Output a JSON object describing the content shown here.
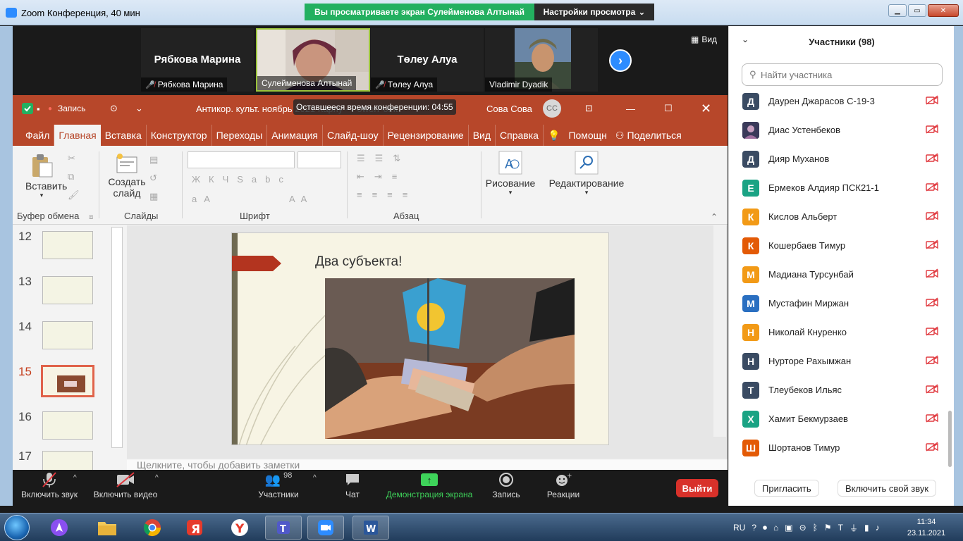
{
  "window": {
    "title": "Zoom Конференция, 40 мин",
    "share_banner": "Вы просматриваете экран Сулейменова Алтынай",
    "view_settings": "Настройки просмотра"
  },
  "videos": [
    {
      "big_name": "Рябкова Марина",
      "tag": "Рябкова Марина",
      "muted": true
    },
    {
      "big_name": "",
      "tag": "Сулейменова Алтынай",
      "muted": false,
      "active": true
    },
    {
      "big_name": "Төлеу Алуа",
      "tag": "Төлеу Алуа",
      "muted": true
    },
    {
      "big_name": "",
      "tag": "Vladimir Dyadik",
      "muted": false
    }
  ],
  "view_label": "Вид",
  "ppt": {
    "record_label": "Запись",
    "doc_title": "Антикор. культ. ноябрь 2021 Карпу - PowerPoint",
    "timer": "Оставшееся время конференции: 04:55",
    "user": "Сова Сова",
    "user_initials": "СС",
    "tabs": [
      "Файл",
      "Главная",
      "Вставка",
      "Конструктор",
      "Переходы",
      "Анимация",
      "Слайд-шоу",
      "Рецензирование",
      "Вид",
      "Справка"
    ],
    "help": "Помощн",
    "share": "Поделиться",
    "ribbon": {
      "paste": "Вставить",
      "create": "Создать",
      "slide": "слайд",
      "drawing": "Рисование",
      "editing": "Редактирование",
      "groups": [
        "Буфер обмена",
        "Слайды",
        "Шрифт",
        "Абзац"
      ]
    },
    "thumb_numbers": [
      "12",
      "13",
      "14",
      "15",
      "16",
      "17"
    ],
    "selected_slide": "15",
    "slide_title": "Два субъекта!",
    "notes": "Щелкните, чтобы добавить заметки"
  },
  "panel": {
    "title": "Участники (98)",
    "search_placeholder": "Найти участника",
    "participants": [
      {
        "initial": "Д",
        "name": "Даурен Джарасов С-19-3",
        "color": "#3a4b63"
      },
      {
        "initial": "",
        "name": "Диас Устенбеков",
        "color": "#555",
        "photo": true
      },
      {
        "initial": "Д",
        "name": "Дияр Муханов",
        "color": "#3a4b63"
      },
      {
        "initial": "Е",
        "name": "Ермеков Алдияр ПСК21-1",
        "color": "#1aa384"
      },
      {
        "initial": "К",
        "name": "Кислов Альберт",
        "color": "#f29a16"
      },
      {
        "initial": "К",
        "name": "Кошербаев Тимур",
        "color": "#e35a06"
      },
      {
        "initial": "М",
        "name": "Мадиана Турсунбай",
        "color": "#f29a16"
      },
      {
        "initial": "М",
        "name": "Мустафин Миржан",
        "color": "#2a6fc1"
      },
      {
        "initial": "Н",
        "name": "Николай Кнуренко",
        "color": "#f29a16"
      },
      {
        "initial": "Н",
        "name": "Нурторе Рахымжан",
        "color": "#3a4b63"
      },
      {
        "initial": "Т",
        "name": "Тлеубеков Ильяс",
        "color": "#3a4b63"
      },
      {
        "initial": "Х",
        "name": "Хамит Бекмурзаев",
        "color": "#1aa384"
      },
      {
        "initial": "Ш",
        "name": "Шортанов Тимур",
        "color": "#e35a06"
      }
    ],
    "invite": "Пригласить",
    "unmute_me": "Включить свой звук"
  },
  "toolbar": {
    "mic": "Включить звук",
    "video": "Включить видео",
    "participants": "Участники",
    "participants_count": "98",
    "chat": "Чат",
    "share": "Демонстрация экрана",
    "record": "Запись",
    "reactions": "Реакции",
    "leave": "Выйти"
  },
  "taskbar": {
    "lang": "RU",
    "time": "11:34",
    "date": "23.11.2021"
  }
}
